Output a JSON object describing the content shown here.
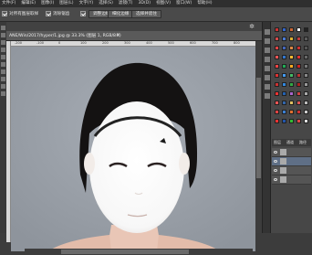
{
  "app": {
    "menu": [
      "文件(F)",
      "编辑(E)",
      "图像(I)",
      "图层(L)",
      "文字(Y)",
      "选择(S)",
      "滤镜(T)",
      "3D(D)",
      "视图(V)",
      "窗口(W)",
      "帮助(H)"
    ]
  },
  "options_bar": {
    "sample_label": "对所有图层取样",
    "sample_checked": true,
    "anti_alias_label": "消除锯齿",
    "anti_alias_checked": true,
    "edge_button": "调整边缘",
    "refine_button": "细化边缘",
    "button3": "选择并遮住"
  },
  "document": {
    "tab_title": "ANE/Win/2017/hyper/1.jpg @ 33.3% (图层 1, RGB/8#)",
    "ruler_labels": [
      "-200",
      "-100",
      "0",
      "100",
      "200",
      "300",
      "400",
      "500",
      "600",
      "700",
      "800"
    ]
  },
  "panels": {
    "tabs": [
      "图层",
      "通道",
      "路径"
    ]
  },
  "colors": {
    "background_gray": "#9aa0a8",
    "workspace": "#3c3c3c",
    "accent_blue": "#5f6f86"
  }
}
